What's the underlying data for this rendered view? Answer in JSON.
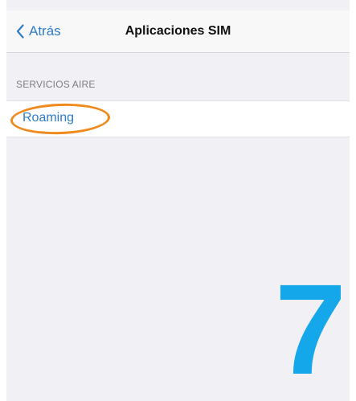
{
  "nav": {
    "back_label": "Atrás",
    "title": "Aplicaciones SIM",
    "back_icon": "chevron-left-icon"
  },
  "section": {
    "header": "SERVICIOS AIRE",
    "items": [
      {
        "label": "Roaming"
      }
    ]
  },
  "annotation": {
    "step_number": "7",
    "highlight_color": "#f08a1d",
    "step_color": "#14a7ea"
  },
  "colors": {
    "accent": "#2f7cc7",
    "background": "#f1f1f5",
    "nav_background": "#f8f8f8"
  }
}
